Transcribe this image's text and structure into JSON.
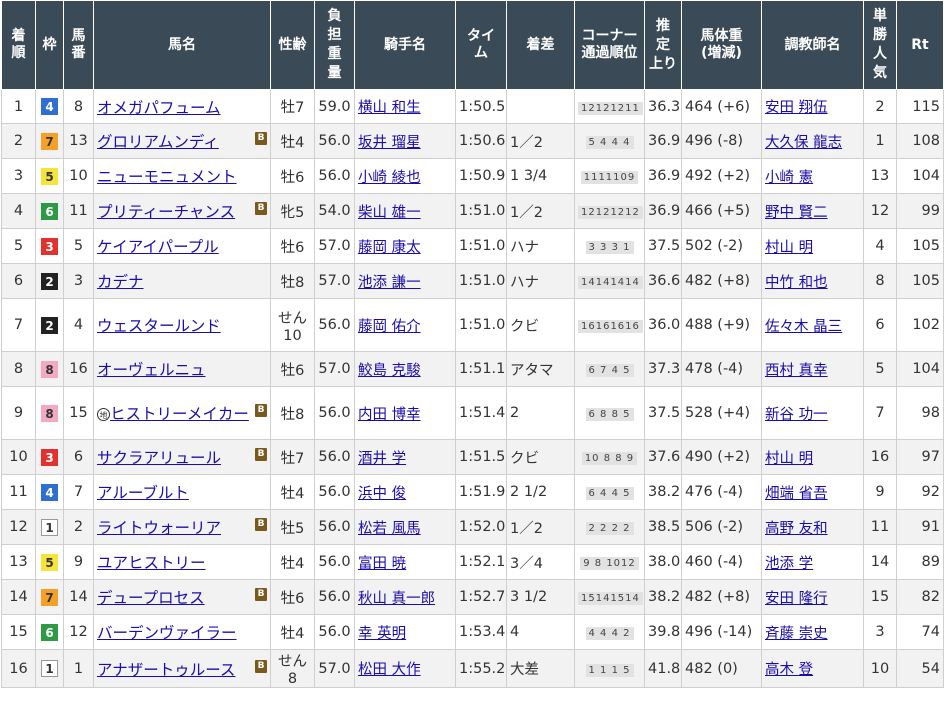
{
  "headers": {
    "rank": [
      "着",
      "順"
    ],
    "waku": "枠",
    "umaban": [
      "馬",
      "番"
    ],
    "horse": "馬名",
    "sexage": "性齢",
    "weight": [
      "負",
      "担",
      "重",
      "量"
    ],
    "jockey": "騎手名",
    "time": [
      "タイ",
      "ム"
    ],
    "margin": "着差",
    "corner": [
      "コーナー",
      "通過順位"
    ],
    "last3f": [
      "推",
      "定",
      "上り"
    ],
    "body": [
      "馬体重",
      "(増減)"
    ],
    "trainer": "調教師名",
    "pop": [
      "単",
      "勝",
      "人",
      "気"
    ],
    "rt": "Rt"
  },
  "waku_colors": {
    "1": {
      "bg": "#ffffff",
      "fg": "#333333",
      "border": "#999999"
    },
    "2": {
      "bg": "#222222",
      "fg": "#ffffff",
      "border": "#222222"
    },
    "3": {
      "bg": "#e3312f",
      "fg": "#ffffff",
      "border": "#e3312f"
    },
    "4": {
      "bg": "#2f6fd1",
      "fg": "#ffffff",
      "border": "#2f6fd1"
    },
    "5": {
      "bg": "#f6e43a",
      "fg": "#333333",
      "border": "#f6e43a"
    },
    "6": {
      "bg": "#2e9a46",
      "fg": "#ffffff",
      "border": "#2e9a46"
    },
    "7": {
      "bg": "#f5a029",
      "fg": "#333333",
      "border": "#f5a029"
    },
    "8": {
      "bg": "#f5a9c0",
      "fg": "#333333",
      "border": "#f5a9c0"
    }
  },
  "blinker_label": "B",
  "chiho_mark": "地",
  "rows": [
    {
      "rank": "1",
      "waku": "4",
      "umaban": "8",
      "horse": "オメガパフューム",
      "blinker": false,
      "chiho": false,
      "sexage": "牡7",
      "weight": "59.0",
      "jockey": "横山 和生",
      "time": "1:50.5",
      "margin": "",
      "corner": "12121211",
      "last3f": "36.3",
      "body": "464 (+6)",
      "trainer": "安田 翔伍",
      "pop": "2",
      "rt": "115"
    },
    {
      "rank": "2",
      "waku": "7",
      "umaban": "13",
      "horse": "グロリアムンディ",
      "blinker": true,
      "chiho": false,
      "sexage": "牡4",
      "weight": "56.0",
      "jockey": "坂井 瑠星",
      "time": "1:50.6",
      "margin": "1／2",
      "corner": "5 4 4 4",
      "last3f": "36.9",
      "body": "496 (-8)",
      "trainer": "大久保 龍志",
      "pop": "1",
      "rt": "108"
    },
    {
      "rank": "3",
      "waku": "5",
      "umaban": "10",
      "horse": "ニューモニュメント",
      "blinker": false,
      "chiho": false,
      "sexage": "牡6",
      "weight": "56.0",
      "jockey": "小崎 綾也",
      "time": "1:50.9",
      "margin": "1 3/4",
      "corner": "1111109",
      "last3f": "36.9",
      "body": "492 (+2)",
      "trainer": "小崎 憲",
      "pop": "13",
      "rt": "104"
    },
    {
      "rank": "4",
      "waku": "6",
      "umaban": "11",
      "horse": "プリティーチャンス",
      "blinker": true,
      "chiho": false,
      "sexage": "牝5",
      "weight": "54.0",
      "jockey": "柴山 雄一",
      "time": "1:51.0",
      "margin": "1／2",
      "corner": "12121212",
      "last3f": "36.9",
      "body": "466 (+5)",
      "trainer": "野中 賢二",
      "pop": "12",
      "rt": "99"
    },
    {
      "rank": "5",
      "waku": "3",
      "umaban": "5",
      "horse": "ケイアイパープル",
      "blinker": false,
      "chiho": false,
      "sexage": "牡6",
      "weight": "57.0",
      "jockey": "藤岡 康太",
      "time": "1:51.0",
      "margin": "ハナ",
      "corner": "3 3 3 1",
      "last3f": "37.5",
      "body": "502 (-2)",
      "trainer": "村山 明",
      "pop": "4",
      "rt": "105"
    },
    {
      "rank": "6",
      "waku": "2",
      "umaban": "3",
      "horse": "カデナ",
      "blinker": false,
      "chiho": false,
      "sexage": "牡8",
      "weight": "57.0",
      "jockey": "池添 謙一",
      "time": "1:51.0",
      "margin": "ハナ",
      "corner": "14141414",
      "last3f": "36.6",
      "body": "482 (+8)",
      "trainer": "中竹 和也",
      "pop": "8",
      "rt": "105"
    },
    {
      "rank": "7",
      "waku": "2",
      "umaban": "4",
      "horse": "ウェスタールンド",
      "blinker": false,
      "chiho": false,
      "sexage": "せん10",
      "weight": "56.0",
      "jockey": "藤岡 佑介",
      "time": "1:51.0",
      "margin": "クビ",
      "corner": "16161616",
      "last3f": "36.0",
      "body": "488 (+9)",
      "trainer": "佐々木 晶三",
      "pop": "6",
      "rt": "102"
    },
    {
      "rank": "8",
      "waku": "8",
      "umaban": "16",
      "horse": "オーヴェルニュ",
      "blinker": false,
      "chiho": false,
      "sexage": "牡6",
      "weight": "57.0",
      "jockey": "鮫島 克駿",
      "time": "1:51.1",
      "margin": "アタマ",
      "corner": "6 7 4 5",
      "last3f": "37.3",
      "body": "478 (-4)",
      "trainer": "西村 真幸",
      "pop": "5",
      "rt": "104"
    },
    {
      "rank": "9",
      "waku": "8",
      "umaban": "15",
      "horse": "ヒストリーメイカー",
      "blinker": true,
      "chiho": true,
      "sexage": "牡8",
      "weight": "56.0",
      "jockey": "内田 博幸",
      "time": "1:51.4",
      "margin": "2",
      "corner": "6 8 8 5",
      "last3f": "37.5",
      "body": "528 (+4)",
      "trainer": "新谷 功一",
      "pop": "7",
      "rt": "98"
    },
    {
      "rank": "10",
      "waku": "3",
      "umaban": "6",
      "horse": "サクラアリュール",
      "blinker": true,
      "chiho": false,
      "sexage": "牡7",
      "weight": "56.0",
      "jockey": "酒井 学",
      "time": "1:51.5",
      "margin": "クビ",
      "corner": "10 8 8 9",
      "last3f": "37.6",
      "body": "490 (+2)",
      "trainer": "村山 明",
      "pop": "16",
      "rt": "97"
    },
    {
      "rank": "11",
      "waku": "4",
      "umaban": "7",
      "horse": "アルーブルト",
      "blinker": false,
      "chiho": false,
      "sexage": "牡4",
      "weight": "56.0",
      "jockey": "浜中 俊",
      "time": "1:51.9",
      "margin": "2 1/2",
      "corner": "6 4 4 5",
      "last3f": "38.2",
      "body": "476 (-4)",
      "trainer": "畑端 省吾",
      "pop": "9",
      "rt": "92"
    },
    {
      "rank": "12",
      "waku": "1",
      "umaban": "2",
      "horse": "ライトウォーリア",
      "blinker": true,
      "chiho": false,
      "sexage": "牡5",
      "weight": "56.0",
      "jockey": "松若 風馬",
      "time": "1:52.0",
      "margin": "1／2",
      "corner": "2 2 2 2",
      "last3f": "38.5",
      "body": "506 (-2)",
      "trainer": "高野 友和",
      "pop": "11",
      "rt": "91"
    },
    {
      "rank": "13",
      "waku": "5",
      "umaban": "9",
      "horse": "ユアヒストリー",
      "blinker": false,
      "chiho": false,
      "sexage": "牡4",
      "weight": "56.0",
      "jockey": "富田 暁",
      "time": "1:52.1",
      "margin": "3／4",
      "corner": "9 8 1012",
      "last3f": "38.0",
      "body": "460 (-4)",
      "trainer": "池添 学",
      "pop": "14",
      "rt": "89"
    },
    {
      "rank": "14",
      "waku": "7",
      "umaban": "14",
      "horse": "デュープロセス",
      "blinker": true,
      "chiho": false,
      "sexage": "牡6",
      "weight": "56.0",
      "jockey": "秋山 真一郎",
      "time": "1:52.7",
      "margin": "3 1/2",
      "corner": "15141514",
      "last3f": "38.2",
      "body": "482 (+8)",
      "trainer": "安田 隆行",
      "pop": "15",
      "rt": "82"
    },
    {
      "rank": "15",
      "waku": "6",
      "umaban": "12",
      "horse": "バーデンヴァイラー",
      "blinker": false,
      "chiho": false,
      "sexage": "牡4",
      "weight": "56.0",
      "jockey": "幸 英明",
      "time": "1:53.4",
      "margin": "4",
      "corner": "4 4 4 2",
      "last3f": "39.8",
      "body": "496 (-14)",
      "trainer": "斉藤 崇史",
      "pop": "3",
      "rt": "74"
    },
    {
      "rank": "16",
      "waku": "1",
      "umaban": "1",
      "horse": "アナザートゥルース",
      "blinker": true,
      "chiho": false,
      "sexage": "せん8",
      "weight": "57.0",
      "jockey": "松田 大作",
      "time": "1:55.2",
      "margin": "大差",
      "corner": "1 1 1 5",
      "last3f": "41.8",
      "body": "482 (0)",
      "trainer": "高木 登",
      "pop": "10",
      "rt": "54"
    }
  ]
}
